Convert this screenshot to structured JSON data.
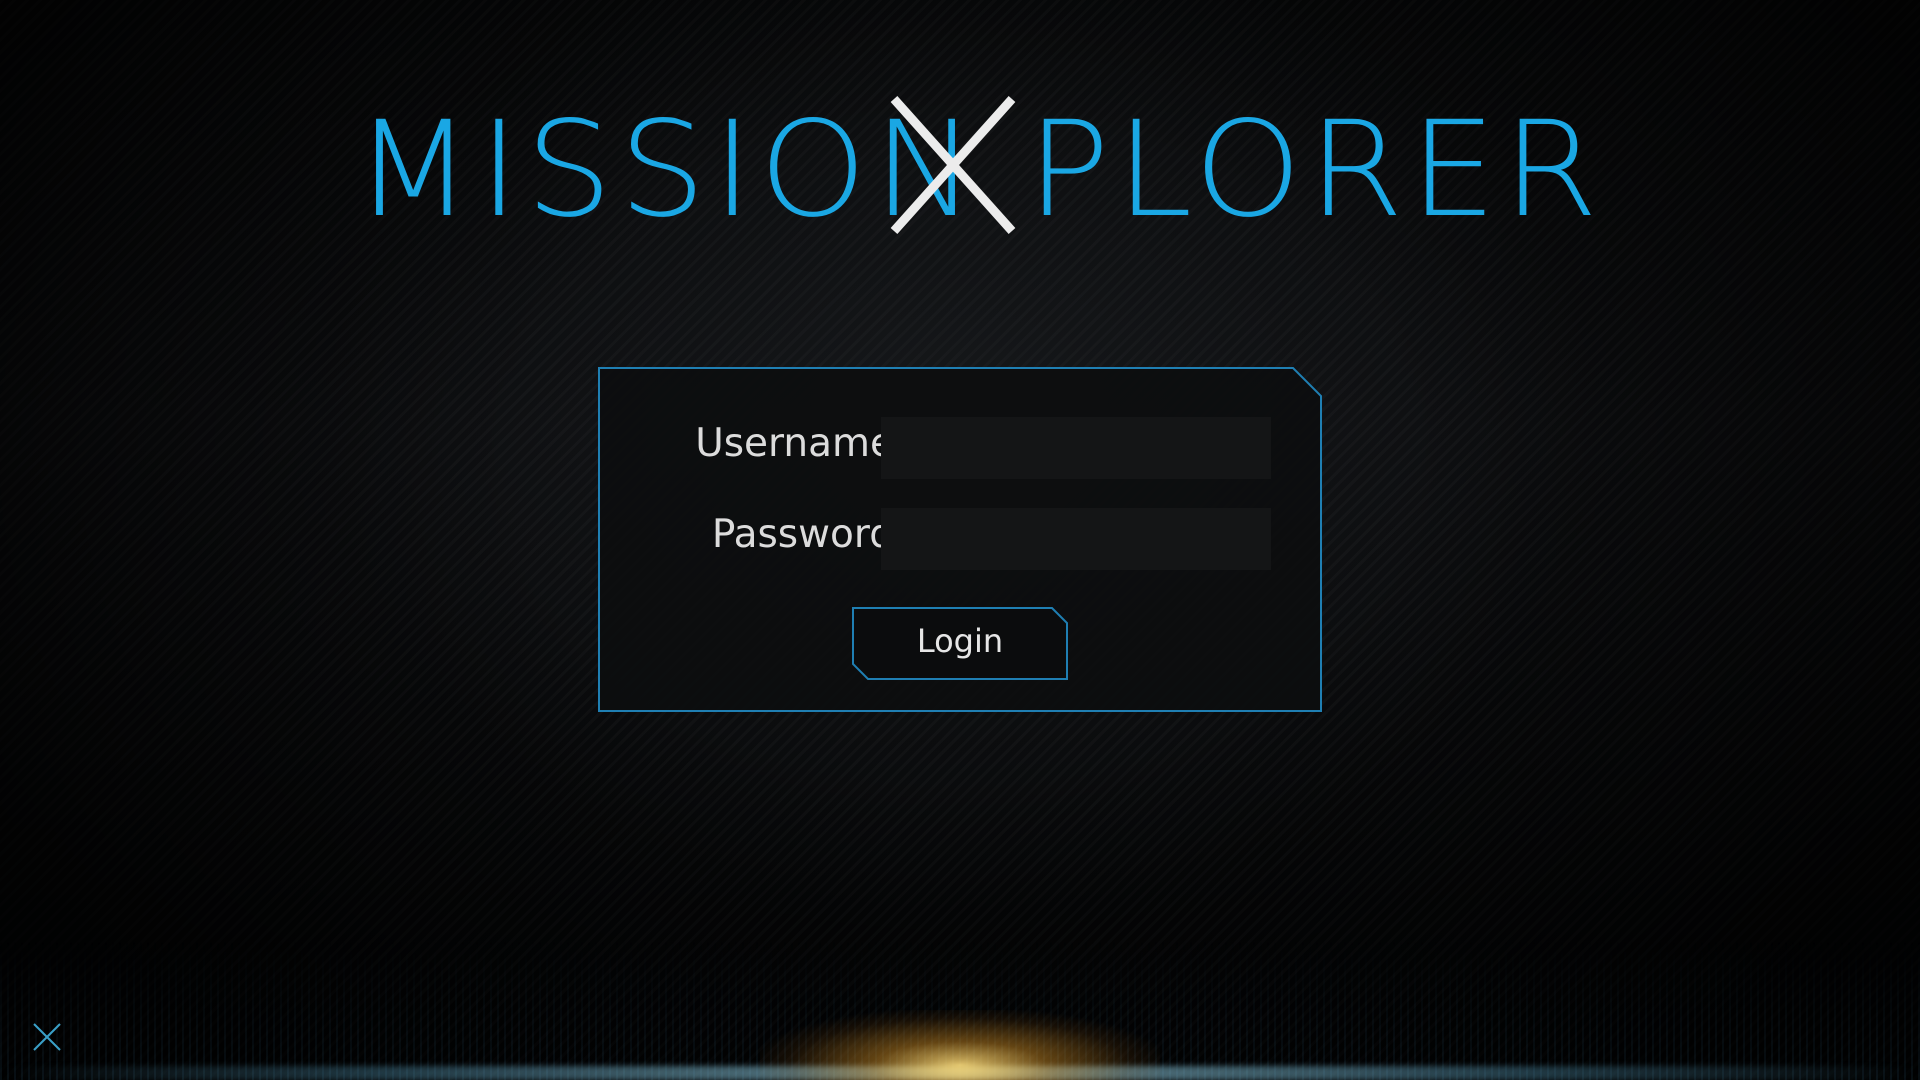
{
  "app": {
    "logo_left": "MISSION",
    "logo_x": "X",
    "logo_right": "PLORER"
  },
  "login_form": {
    "username_label": "Username",
    "username_value": "",
    "password_label": "Password",
    "password_value": "",
    "login_button_label": "Login"
  },
  "icons": {
    "close": "close-icon"
  },
  "colors": {
    "accent": "#1aa7e4",
    "logo_x": "#ececec",
    "panel_border": "#1f7fb3",
    "background": "#050607"
  }
}
